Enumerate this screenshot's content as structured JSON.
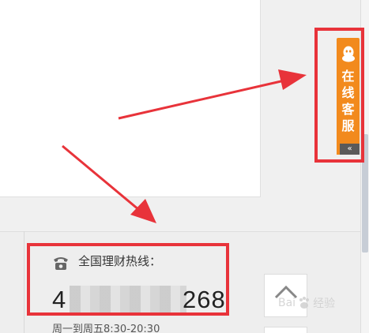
{
  "service_tab": {
    "label": "在线客服",
    "collapse_label": "«",
    "icon": "qq-penguin-icon"
  },
  "hotline": {
    "label": "全国理财热线：",
    "number_start": "4",
    "number_end": "268",
    "hours": "周一到周五8:30-20:30",
    "icon": "telephone-icon"
  },
  "back_to_top": {
    "icon": "chevron-up-icon"
  },
  "watermark": {
    "text_before": "Bai",
    "text_after": "经验"
  },
  "colors": {
    "service_orange": "#f28a1d",
    "annotation_red": "#e8333a"
  }
}
